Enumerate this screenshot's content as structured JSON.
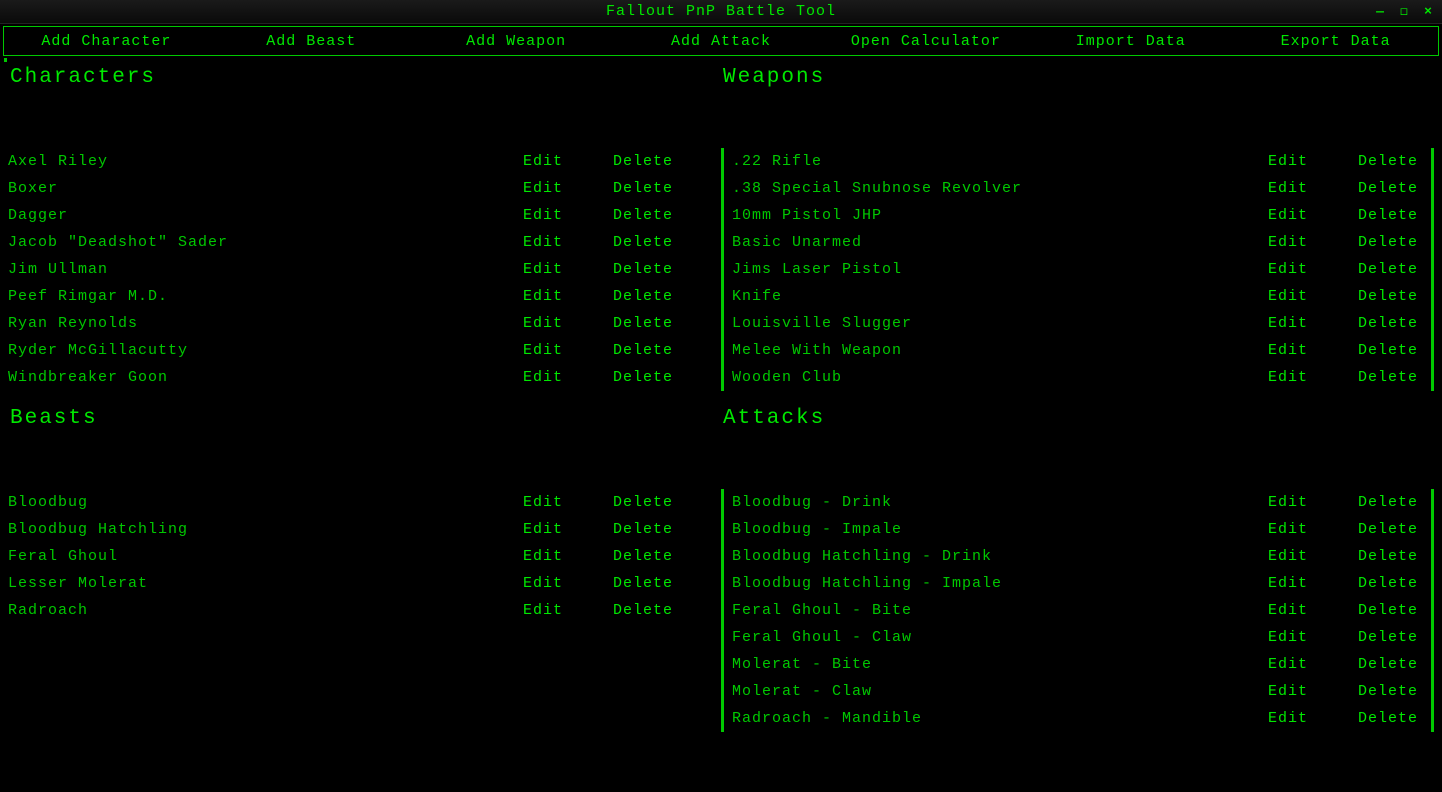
{
  "window": {
    "title": "Fallout PnP Battle Tool",
    "controls": {
      "minimize": "—",
      "maximize": "◻",
      "close": "×"
    }
  },
  "toolbar": {
    "items": [
      "Add Character",
      "Add Beast",
      "Add Weapon",
      "Add Attack",
      "Open Calculator",
      "Import Data",
      "Export Data"
    ]
  },
  "labels": {
    "edit": "Edit",
    "delete": "Delete"
  },
  "panels": {
    "characters": {
      "title": "Characters",
      "items": [
        "Axel Riley",
        "Boxer",
        "Dagger",
        "Jacob \"Deadshot\" Sader",
        "Jim Ullman",
        "Peef Rimgar M.D.",
        "Ryan Reynolds",
        "Ryder McGillacutty",
        "Windbreaker Goon"
      ]
    },
    "weapons": {
      "title": "Weapons",
      "items": [
        ".22 Rifle",
        ".38 Special Snubnose Revolver",
        "10mm Pistol JHP",
        "Basic Unarmed",
        "Jims Laser Pistol",
        "Knife",
        "Louisville Slugger",
        "Melee With Weapon",
        "Wooden Club"
      ]
    },
    "beasts": {
      "title": "Beasts",
      "items": [
        "Bloodbug",
        "Bloodbug Hatchling",
        "Feral Ghoul",
        "Lesser Molerat",
        "Radroach"
      ]
    },
    "attacks": {
      "title": "Attacks",
      "items": [
        "Bloodbug - Drink",
        "Bloodbug - Impale",
        "Bloodbug Hatchling - Drink",
        "Bloodbug Hatchling - Impale",
        "Feral Ghoul - Bite",
        "Feral Ghoul - Claw",
        "Molerat - Bite",
        "Molerat - Claw",
        "Radroach - Mandible"
      ]
    }
  }
}
